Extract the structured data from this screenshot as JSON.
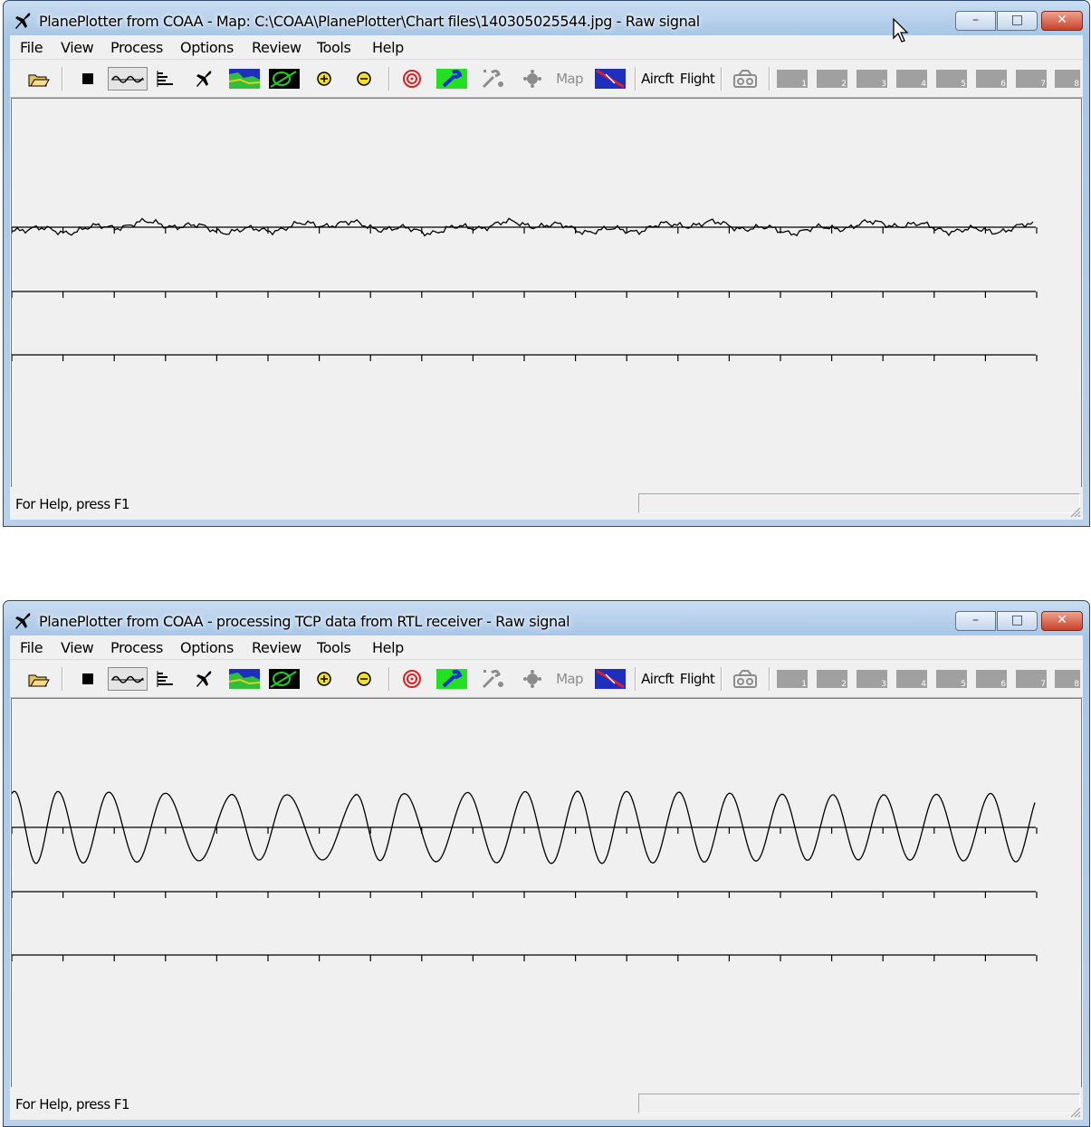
{
  "windows": [
    {
      "title": "PlanePlotter from COAA - Map: C:\\COAA\\PlanePlotter\\Chart files\\140305025544.jpg - Raw signal",
      "signal": "flat-noise",
      "status_text": "For Help, press F1"
    },
    {
      "title": "PlanePlotter from COAA - processing TCP data from RTL receiver - Raw signal",
      "signal": "sine",
      "status_text": "For Help, press F1"
    }
  ],
  "menu": [
    "File",
    "View",
    "Process",
    "Options",
    "Review",
    "Tools",
    "Help"
  ],
  "caption_buttons": {
    "minimize": "–",
    "maximize": "□",
    "close": "✕"
  },
  "toolbar": {
    "aircraft_label": "Aircft",
    "flight_label": "Flight",
    "map_label": "Map",
    "slots": [
      "1",
      "2",
      "3",
      "4",
      "5",
      "6",
      "7",
      "8"
    ]
  },
  "colors": {
    "title_gradient_top": "#c9ddf1",
    "close_red": "#c8422a",
    "plot_bg": "#f0f0f0",
    "trace": "#000000"
  }
}
